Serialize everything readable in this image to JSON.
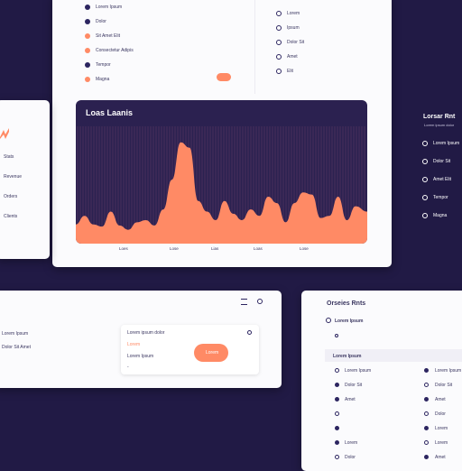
{
  "top_panel": {
    "menu_items": [
      {
        "label": "Lorem Ipsum",
        "icon": "dark-circle"
      },
      {
        "label": "Dolor",
        "icon": "dark-circle"
      },
      {
        "label": "Sit Amet Elit",
        "icon": "orange-circle"
      },
      {
        "label": "Consectetur Adipis",
        "icon": "orange-circle"
      },
      {
        "label": "Tempor",
        "icon": "dark-circle"
      },
      {
        "label": "Magna",
        "icon": "orange-circle"
      }
    ],
    "right_items": [
      {
        "label": "Lorem",
        "icon": "ring-circle"
      },
      {
        "label": "Ipsum",
        "icon": "ring-circle"
      },
      {
        "label": "Dolor Sit",
        "icon": "ring-circle"
      },
      {
        "label": "Amet",
        "icon": "ring-circle"
      },
      {
        "label": "Elit",
        "icon": "ring-circle"
      }
    ]
  },
  "left_card": {
    "items": [
      "Stats",
      "Revenue",
      "Orders",
      "Clients"
    ]
  },
  "chart_panel": {
    "title": "Loas Laanis"
  },
  "chart_data": {
    "type": "area",
    "title": "Loas Laanis",
    "x_labels": [
      "Loes",
      "Lose",
      "Lias",
      "Loas",
      "Lose"
    ],
    "x": [
      0,
      0.03,
      0.06,
      0.09,
      0.12,
      0.15,
      0.18,
      0.21,
      0.24,
      0.27,
      0.3,
      0.33,
      0.36,
      0.39,
      0.42,
      0.45,
      0.48,
      0.51,
      0.54,
      0.57,
      0.6,
      0.63,
      0.66,
      0.69,
      0.72,
      0.75,
      0.78,
      0.81,
      0.84,
      0.87,
      0.9,
      0.93,
      0.96,
      1.0
    ],
    "values": [
      18,
      26,
      18,
      16,
      30,
      17,
      13,
      20,
      22,
      17,
      32,
      60,
      95,
      90,
      40,
      30,
      22,
      40,
      28,
      22,
      32,
      26,
      44,
      38,
      20,
      38,
      48,
      46,
      24,
      26,
      44,
      22,
      35,
      30
    ],
    "ylim": [
      0,
      110
    ],
    "grid": true,
    "colors": {
      "fill": "#ff8a65",
      "background": "#2b2150"
    }
  },
  "right_side": {
    "title": "Lorsar Rnt",
    "subtitle": "Lorem ipsum dolor",
    "items": [
      "Lorem Ipsum",
      "Dolor Sit",
      "Amet Elit",
      "Tempor",
      "Magna"
    ]
  },
  "bottom_left_card": {
    "list": [
      "Lorem Ipsum",
      "Dolor Sit Amet"
    ],
    "text_rows": [
      "Lorem ipsum dolor",
      "Lorem Ipsum"
    ],
    "tag": "Lorem",
    "button_label": "Lorem"
  },
  "bottom_right_card": {
    "title": "Orseies Rnts",
    "subtitle": "Lorem Ipsum",
    "section_label": "Lorem Ipsum",
    "left_col": [
      "Lorem Ipsum",
      "Dolor Sit",
      "Amet",
      "",
      "",
      "Lorem",
      "Dolor"
    ],
    "right_col": [
      "Lorem Ipsum",
      "Dolor Sit",
      "Amet",
      "Dolor",
      "Lorem",
      "Lorem",
      "Amet"
    ]
  },
  "colors": {
    "accent": "#ff8a65",
    "navy": "#211a45",
    "card": "#fbfbfd"
  }
}
